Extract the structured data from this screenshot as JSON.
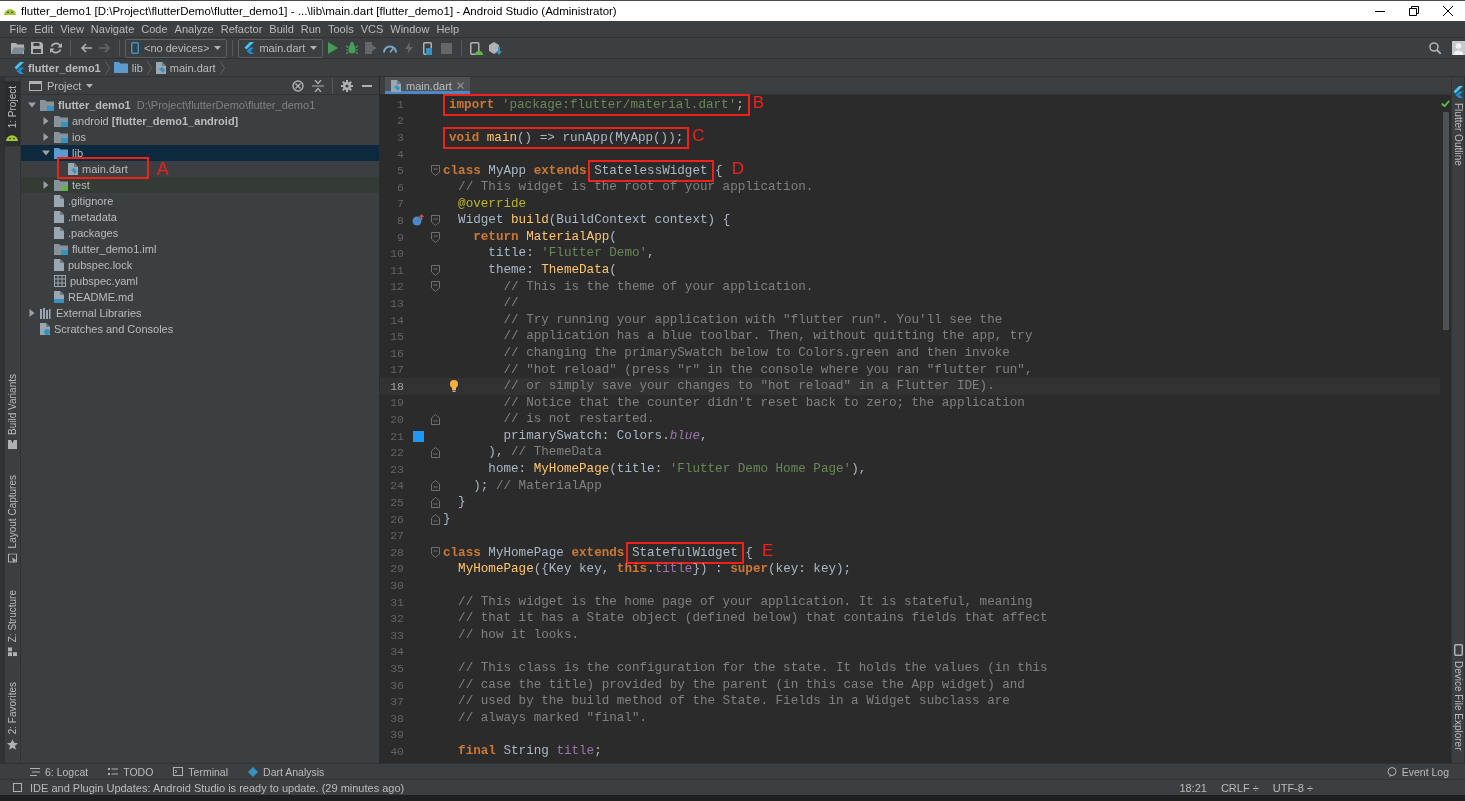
{
  "window": {
    "title": "flutter_demo1 [D:\\Project\\flutterDemo\\flutter_demo1] - ...\\lib\\main.dart [flutter_demo1] - Android Studio (Administrator)"
  },
  "menu": [
    "File",
    "Edit",
    "View",
    "Navigate",
    "Code",
    "Analyze",
    "Refactor",
    "Build",
    "Run",
    "Tools",
    "VCS",
    "Window",
    "Help"
  ],
  "toolbar": [
    {
      "kind": "open",
      "disabled": false
    },
    {
      "kind": "save",
      "disabled": false
    },
    {
      "kind": "sync",
      "disabled": false
    },
    {
      "kind": "separator"
    },
    {
      "kind": "back",
      "disabled": false
    },
    {
      "kind": "forward",
      "disabled": true
    },
    {
      "kind": "separator"
    },
    {
      "kind": "device_selector",
      "label": "<no devices>"
    },
    {
      "kind": "separator"
    },
    {
      "kind": "run_config",
      "label": "main.dart"
    },
    {
      "kind": "run",
      "disabled": false
    },
    {
      "kind": "debug",
      "disabled": false
    },
    {
      "kind": "coverage",
      "disabled": true
    },
    {
      "kind": "profile",
      "disabled": false
    },
    {
      "kind": "hot_reload",
      "disabled": true
    },
    {
      "kind": "attach",
      "disabled": false
    },
    {
      "kind": "stop",
      "disabled": true
    },
    {
      "kind": "separator"
    },
    {
      "kind": "avd_manager",
      "disabled": false
    },
    {
      "kind": "sdk_manager",
      "disabled": false
    }
  ],
  "breadcrumbs": [
    {
      "kind": "project",
      "label": "flutter_demo1"
    },
    {
      "kind": "folder",
      "label": "lib"
    },
    {
      "kind": "dart_file",
      "label": "main.dart"
    }
  ],
  "left_strip": {
    "top": [
      {
        "kind": "project",
        "label": "1: Project",
        "selected": true
      }
    ],
    "bottom": [
      {
        "kind": "variants",
        "label": "Build Variants",
        "selected": false
      },
      {
        "kind": "captures",
        "label": "Layout Captures",
        "selected": false
      },
      {
        "kind": "structure",
        "label": "Z: Structure",
        "selected": false
      },
      {
        "kind": "favorites",
        "label": "2: Favorites",
        "selected": false
      }
    ]
  },
  "project_panel": {
    "title": "Project",
    "tree": [
      {
        "kind": "project",
        "label": "flutter_demo1",
        "path": "D:\\Project\\flutterDemo\\flutter_demo1",
        "expanded": true,
        "selected": false,
        "children": [
          {
            "kind": "module_folder",
            "label": "android **[flutter_demo1_android]**",
            "expanded": false,
            "selected": false
          },
          {
            "kind": "module_folder",
            "label": "ios",
            "expanded": false,
            "selected": false
          },
          {
            "kind": "folder",
            "label": "lib",
            "expanded": true,
            "selected": true,
            "children": [
              {
                "kind": "dart_file",
                "label": "main.dart",
                "selected": false,
                "callout": "A"
              }
            ]
          },
          {
            "kind": "test_folder",
            "label": "test",
            "expanded": false,
            "selected": false
          },
          {
            "kind": "text_file",
            "label": ".gitignore",
            "selected": false
          },
          {
            "kind": "text_file",
            "label": ".metadata",
            "selected": false
          },
          {
            "kind": "text_file",
            "label": ".packages",
            "selected": false
          },
          {
            "kind": "module_file",
            "label": "flutter_demo1.iml",
            "selected": false
          },
          {
            "kind": "text_file",
            "label": "pubspec.lock",
            "selected": false
          },
          {
            "kind": "yaml_file",
            "label": "pubspec.yaml",
            "selected": false
          },
          {
            "kind": "markdown_file",
            "label": "README.md",
            "selected": false
          }
        ]
      },
      {
        "kind": "libraries",
        "label": "External Libraries",
        "expanded": false,
        "selected": false
      },
      {
        "kind": "scratches",
        "label": "Scratches and Consoles",
        "selected": false
      }
    ]
  },
  "editor": {
    "tabs": [
      {
        "label": "main.dart",
        "selected": true
      }
    ],
    "lines": [
      {
        "number": "1",
        "current": false,
        "callout": {
          "label": "B",
          "segments": [
            {
              "kind": "keyword",
              "text": "import "
            },
            {
              "kind": "string",
              "text": "'package:flutter/material.dart'"
            },
            {
              "kind": "plain",
              "text": ";"
            }
          ]
        }
      },
      {
        "number": "2",
        "current": false
      },
      {
        "number": "3",
        "current": false,
        "callout": {
          "label": "C",
          "segments": [
            {
              "kind": "keyword",
              "text": "void "
            },
            {
              "kind": "function",
              "text": "main"
            },
            {
              "kind": "plain",
              "text": "() => runApp(MyApp());"
            }
          ]
        }
      },
      {
        "number": "4",
        "current": false
      },
      {
        "number": "5",
        "current": false,
        "fold": {
          "kind": "start"
        },
        "segments": [
          {
            "kind": "keyword",
            "text": "class"
          },
          {
            "kind": "plain",
            "text": " MyApp "
          },
          {
            "kind": "keyword",
            "text": "extends "
          }
        ],
        "callout": {
          "label": "D",
          "segments": [
            {
              "kind": "plain",
              "text": "StatelessWidget"
            }
          ]
        },
        "tail": [
          {
            "kind": "plain",
            "text": " {"
          }
        ]
      },
      {
        "number": "6",
        "current": false,
        "segments": [
          {
            "kind": "comment",
            "text": "  // This widget is the root of your application."
          }
        ]
      },
      {
        "number": "7",
        "current": false,
        "segments": [
          {
            "kind": "meta",
            "text": "  @override"
          }
        ]
      },
      {
        "number": "8",
        "current": false,
        "fold": {
          "kind": "start"
        },
        "gutter": {
          "kind": "override"
        },
        "segments": [
          {
            "kind": "plain",
            "text": "  Widget "
          },
          {
            "kind": "function",
            "text": "build"
          },
          {
            "kind": "plain",
            "text": "(BuildContext context) {"
          }
        ]
      },
      {
        "number": "9",
        "current": false,
        "fold": {
          "kind": "start"
        },
        "segments": [
          {
            "kind": "keyword",
            "text": "    return "
          },
          {
            "kind": "function",
            "text": "MaterialApp"
          },
          {
            "kind": "plain",
            "text": "("
          }
        ]
      },
      {
        "number": "10",
        "current": false,
        "segments": [
          {
            "kind": "plain",
            "text": "      title: "
          },
          {
            "kind": "string",
            "text": "'Flutter Demo'"
          },
          {
            "kind": "plain",
            "text": ","
          }
        ]
      },
      {
        "number": "11",
        "current": false,
        "fold": {
          "kind": "start"
        },
        "segments": [
          {
            "kind": "plain",
            "text": "      theme: "
          },
          {
            "kind": "function",
            "text": "ThemeData"
          },
          {
            "kind": "plain",
            "text": "("
          }
        ]
      },
      {
        "number": "12",
        "current": false,
        "fold": {
          "kind": "start"
        },
        "segments": [
          {
            "kind": "comment",
            "text": "        // This is the theme of your application."
          }
        ]
      },
      {
        "number": "13",
        "current": false,
        "segments": [
          {
            "kind": "comment",
            "text": "        //"
          }
        ]
      },
      {
        "number": "14",
        "current": false,
        "segments": [
          {
            "kind": "comment",
            "text": "        // Try running your application with \"flutter run\". You'll see the"
          }
        ]
      },
      {
        "number": "15",
        "current": false,
        "segments": [
          {
            "kind": "comment",
            "text": "        // application has a blue toolbar. Then, without quitting the app, try"
          }
        ]
      },
      {
        "number": "16",
        "current": false,
        "segments": [
          {
            "kind": "comment",
            "text": "        // changing the primarySwatch below to Colors.green and then invoke"
          }
        ]
      },
      {
        "number": "17",
        "current": false,
        "segments": [
          {
            "kind": "comment",
            "text": "        // \"hot reload\" (press \"r\" in the console where you ran \"flutter run\","
          }
        ]
      },
      {
        "number": "18",
        "current": true,
        "gutter": {
          "kind": "bulb"
        },
        "segments": [
          {
            "kind": "comment",
            "text": "        // or simply save your changes to \"hot reload\" in a Flutter IDE)."
          }
        ]
      },
      {
        "number": "19",
        "current": false,
        "segments": [
          {
            "kind": "comment",
            "text": "        // Notice that the counter didn't reset back to zero; the application"
          }
        ]
      },
      {
        "number": "20",
        "current": false,
        "fold": {
          "kind": "end"
        },
        "segments": [
          {
            "kind": "comment",
            "text": "        // is not restarted."
          }
        ]
      },
      {
        "number": "21",
        "current": false,
        "gutter": {
          "kind": "swatch",
          "color": "#2196f3"
        },
        "segments": [
          {
            "kind": "plain",
            "text": "        primarySwatch: Colors."
          },
          {
            "kind": "constant",
            "text": "blue"
          },
          {
            "kind": "plain",
            "text": ","
          }
        ]
      },
      {
        "number": "22",
        "current": false,
        "fold": {
          "kind": "end"
        },
        "segments": [
          {
            "kind": "plain",
            "text": "      ), "
          },
          {
            "kind": "comment",
            "text": "// ThemeData"
          }
        ]
      },
      {
        "number": "23",
        "current": false,
        "segments": [
          {
            "kind": "plain",
            "text": "      home: "
          },
          {
            "kind": "function",
            "text": "MyHomePage"
          },
          {
            "kind": "plain",
            "text": "(title: "
          },
          {
            "kind": "string",
            "text": "'Flutter Demo Home Page'"
          },
          {
            "kind": "plain",
            "text": "),"
          }
        ]
      },
      {
        "number": "24",
        "current": false,
        "fold": {
          "kind": "end"
        },
        "segments": [
          {
            "kind": "plain",
            "text": "    ); "
          },
          {
            "kind": "comment",
            "text": "// MaterialApp"
          }
        ]
      },
      {
        "number": "25",
        "current": false,
        "fold": {
          "kind": "end"
        },
        "segments": [
          {
            "kind": "plain",
            "text": "  }"
          }
        ]
      },
      {
        "number": "26",
        "current": false,
        "fold": {
          "kind": "end"
        },
        "segments": [
          {
            "kind": "plain",
            "text": "}"
          }
        ]
      },
      {
        "number": "27",
        "current": false
      },
      {
        "number": "28",
        "current": false,
        "fold": {
          "kind": "start"
        },
        "segments": [
          {
            "kind": "keyword",
            "text": "class"
          },
          {
            "kind": "plain",
            "text": " MyHomePage "
          },
          {
            "kind": "keyword",
            "text": "extends "
          }
        ],
        "callout": {
          "label": "E",
          "segments": [
            {
              "kind": "plain",
              "text": "StatefulWidget"
            }
          ]
        },
        "tail": [
          {
            "kind": "plain",
            "text": " {"
          }
        ]
      },
      {
        "number": "29",
        "current": false,
        "segments": [
          {
            "kind": "function",
            "text": "  MyHomePage"
          },
          {
            "kind": "plain",
            "text": "({Key key, "
          },
          {
            "kind": "keyword",
            "text": "this"
          },
          {
            "kind": "plain",
            "text": "."
          },
          {
            "kind": "field",
            "text": "title"
          },
          {
            "kind": "plain",
            "text": "}) : "
          },
          {
            "kind": "keyword",
            "text": "super"
          },
          {
            "kind": "plain",
            "text": "(key: key);"
          }
        ]
      },
      {
        "number": "30",
        "current": false
      },
      {
        "number": "31",
        "current": false,
        "segments": [
          {
            "kind": "comment",
            "text": "  // This widget is the home page of your application. It is stateful, meaning"
          }
        ]
      },
      {
        "number": "32",
        "current": false,
        "segments": [
          {
            "kind": "comment",
            "text": "  // that it has a State object (defined below) that contains fields that affect"
          }
        ]
      },
      {
        "number": "33",
        "current": false,
        "segments": [
          {
            "kind": "comment",
            "text": "  // how it looks."
          }
        ]
      },
      {
        "number": "34",
        "current": false
      },
      {
        "number": "35",
        "current": false,
        "segments": [
          {
            "kind": "comment",
            "text": "  // This class is the configuration for the state. It holds the values (in this"
          }
        ]
      },
      {
        "number": "36",
        "current": false,
        "segments": [
          {
            "kind": "comment",
            "text": "  // case the title) provided by the parent (in this case the App widget) and"
          }
        ]
      },
      {
        "number": "37",
        "current": false,
        "segments": [
          {
            "kind": "comment",
            "text": "  // used by the build method of the State. Fields in a Widget subclass are"
          }
        ]
      },
      {
        "number": "38",
        "current": false,
        "segments": [
          {
            "kind": "comment",
            "text": "  // always marked \"final\"."
          }
        ]
      },
      {
        "number": "39",
        "current": false
      },
      {
        "number": "40",
        "current": false,
        "segments": [
          {
            "kind": "keyword",
            "text": "  final"
          },
          {
            "kind": "plain",
            "text": " String "
          },
          {
            "kind": "field",
            "text": "title"
          },
          {
            "kind": "plain",
            "text": ";"
          }
        ]
      }
    ]
  },
  "right_strip": {
    "top": [
      {
        "kind": "outline",
        "label": "Flutter Outline",
        "selected": false
      }
    ],
    "bottom": [
      {
        "kind": "device_explorer",
        "label": "Device File Explorer",
        "selected": false
      }
    ]
  },
  "tool_tabs": {
    "left": [
      {
        "kind": "logcat",
        "label": "6: Logcat",
        "selected": false
      },
      {
        "kind": "todo",
        "label": "TODO",
        "selected": false
      },
      {
        "kind": "terminal",
        "label": "Terminal",
        "selected": false
      },
      {
        "kind": "analysis",
        "label": "Dart Analysis",
        "selected": false
      }
    ],
    "right": [
      {
        "kind": "event_log",
        "label": "Event Log",
        "selected": false
      }
    ]
  },
  "status_bar": {
    "message": "IDE and Plugin Updates: Android Studio is ready to update. (29 minutes ago)",
    "items": [
      "18:21",
      "CRLF ÷",
      "UTF-8 ÷"
    ]
  }
}
